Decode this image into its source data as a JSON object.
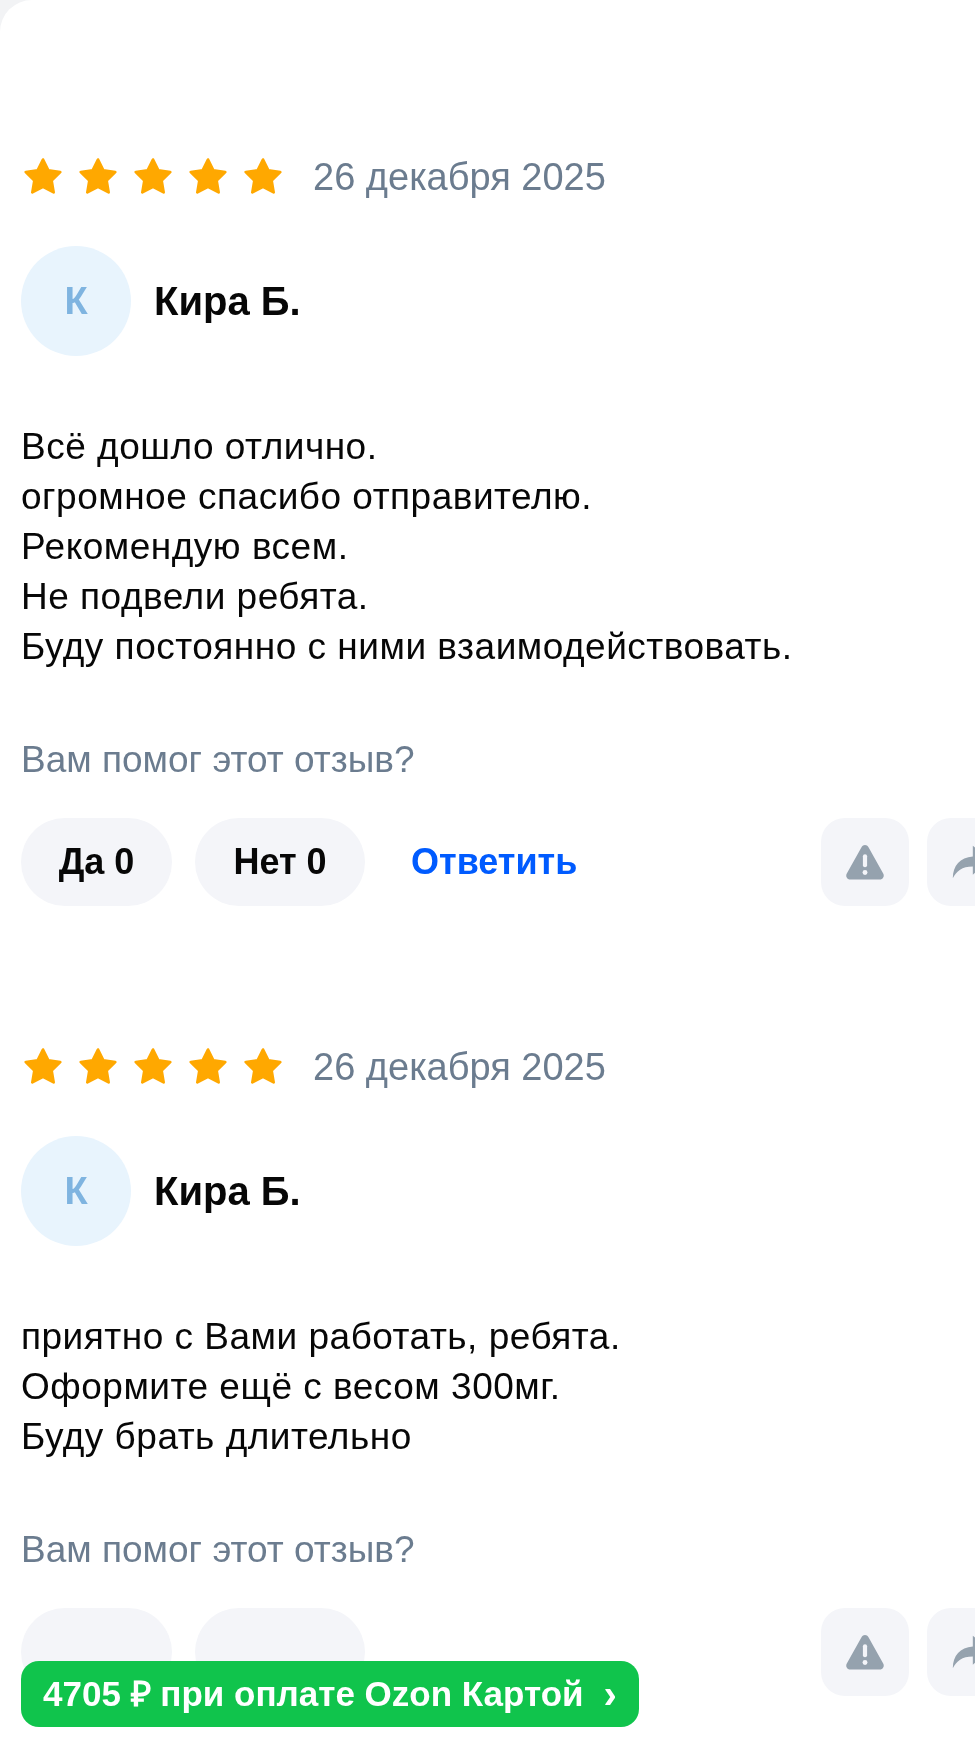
{
  "reviews": [
    {
      "stars": 5,
      "date": "26 декабря 2025",
      "avatar_letter": "К",
      "author": "Кира Б.",
      "text_lines": [
        "Всё дошло отлично.",
        "огромное спасибо отправителю.",
        "Рекомендую всем.",
        "Не подвели ребята.",
        "Буду постоянно с ними взаимодействовать."
      ],
      "question": "Вам помог этот отзыв?",
      "yes": "Да 0",
      "no": "Нет 0",
      "reply": "Ответить"
    },
    {
      "stars": 5,
      "date": "26 декабря 2025",
      "avatar_letter": "К",
      "author": "Кира Б.",
      "text_lines": [
        "приятно с Вами работать, ребята.",
        "Оформите ещё с весом 300мг.",
        "Буду брать длительно"
      ],
      "question": "Вам помог этот отзыв?"
    }
  ],
  "promo_banner": {
    "text": "4705 ₽ при оплате Ozon Картой",
    "arrow": "›"
  }
}
